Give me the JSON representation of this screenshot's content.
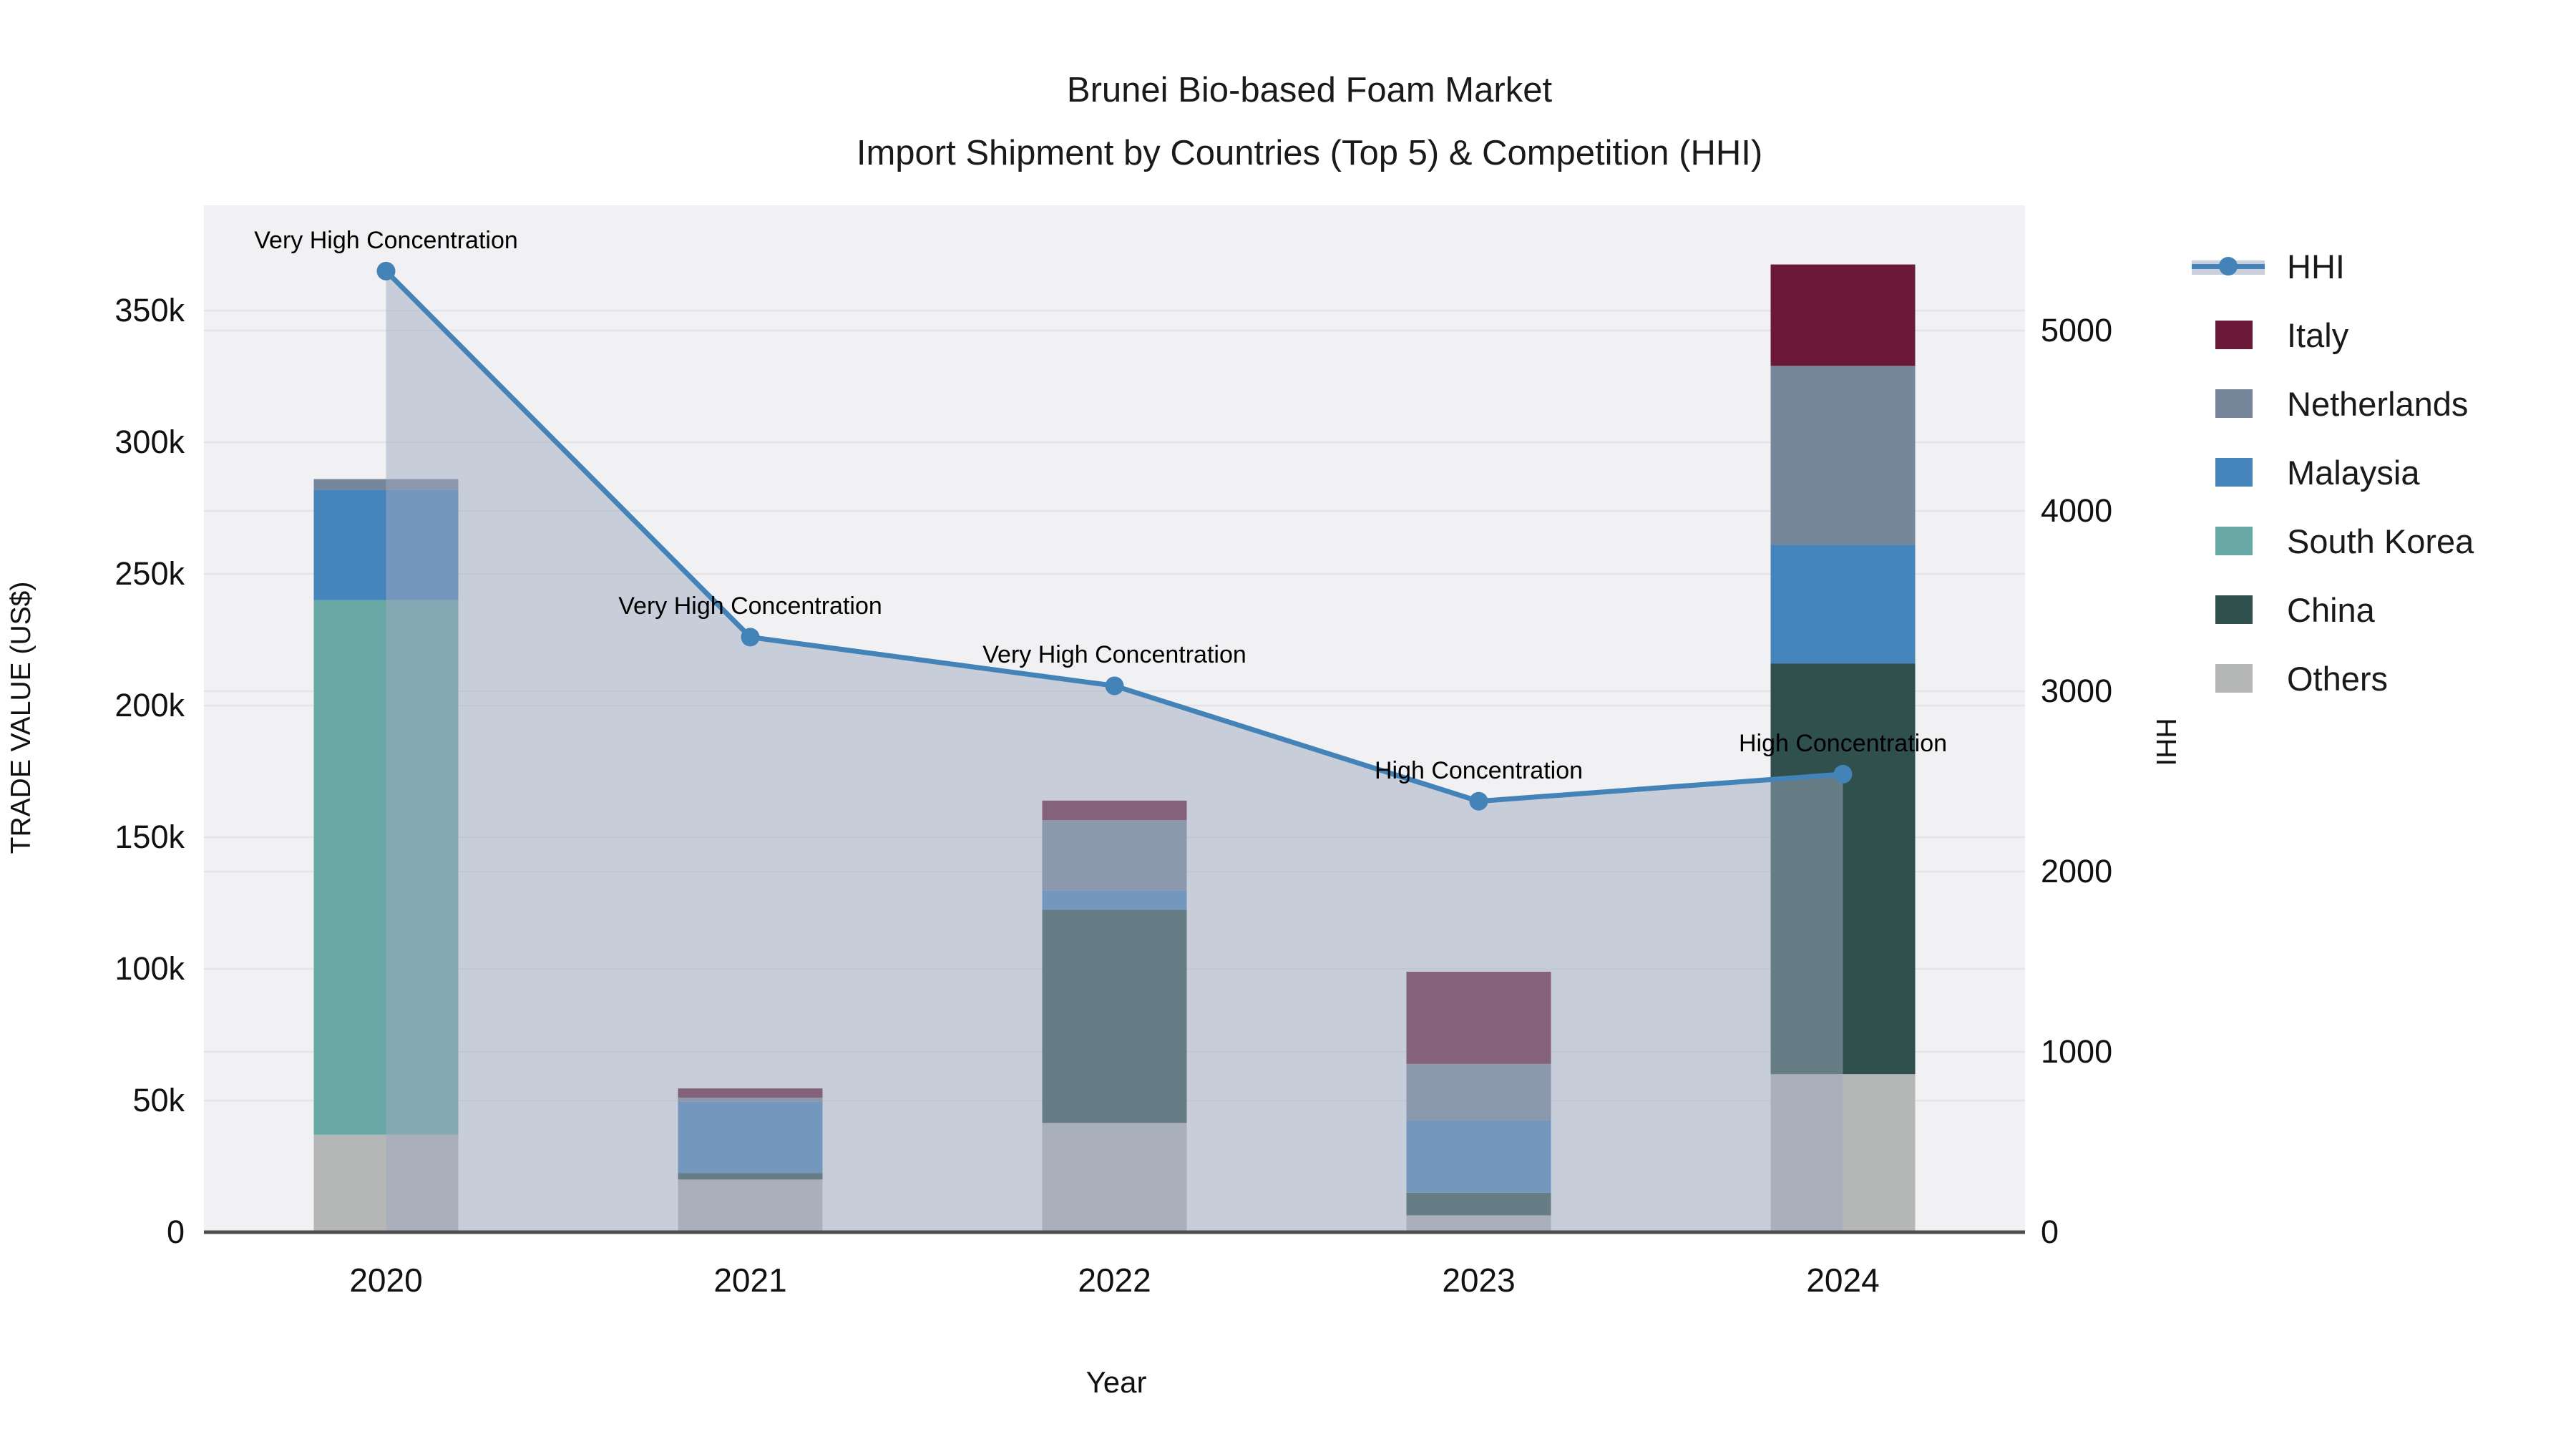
{
  "title": {
    "line1": "Brunei Bio-based Foam Market",
    "line2": "Import Shipment by Countries (Top 5) & Competition (HHI)"
  },
  "axes": {
    "xlabel": "Year",
    "ylabel_left": "TRADE VALUE (US$)",
    "ylabel_right": "HHI",
    "y_left_tick_labels": [
      "0",
      "50k",
      "100k",
      "150k",
      "200k",
      "250k",
      "300k",
      "350k"
    ],
    "y_left_tick_values": [
      0,
      50000,
      100000,
      150000,
      200000,
      250000,
      300000,
      350000
    ],
    "y_right_tick_labels": [
      "0",
      "1000",
      "2000",
      "3000",
      "4000",
      "5000"
    ],
    "y_right_tick_values": [
      0,
      1000,
      2000,
      3000,
      4000,
      5000
    ],
    "ylim_left": [
      0,
      390000
    ],
    "ylim_right": [
      0,
      5700
    ]
  },
  "legend": {
    "items": [
      {
        "label": "HHI",
        "type": "line",
        "color": "#4383b8"
      },
      {
        "label": "Italy",
        "type": "box",
        "color": "#6a1a38"
      },
      {
        "label": "Netherlands",
        "type": "box",
        "color": "#76879c"
      },
      {
        "label": "Malaysia",
        "type": "box",
        "color": "#4685bb"
      },
      {
        "label": "South Korea",
        "type": "box",
        "color": "#68a9a6"
      },
      {
        "label": "China",
        "type": "box",
        "color": "#2f504d"
      },
      {
        "label": "Others",
        "type": "box",
        "color": "#b5b7b7"
      }
    ]
  },
  "colors": {
    "hhi_line": "#4383b8",
    "hhi_area": "rgba(160,170,192,0.5)",
    "plot_bg": "#f1f1f4",
    "grid": "#e4e4e8",
    "axis_line": "#4d4d4d"
  },
  "chart_data": {
    "type": "bar",
    "subtype": "stacked-bars-with-line-overlay",
    "categories": [
      "2020",
      "2021",
      "2022",
      "2023",
      "2024"
    ],
    "stack_order_bottom_to_top": [
      "Others",
      "China",
      "South Korea",
      "Malaysia",
      "Netherlands",
      "Italy"
    ],
    "series": [
      {
        "name": "Others",
        "color": "#b5b7b7",
        "values": [
          37000,
          20000,
          41500,
          6400,
          60000
        ]
      },
      {
        "name": "China",
        "color": "#2f504d",
        "values": [
          0,
          2500,
          81000,
          8600,
          156000
        ]
      },
      {
        "name": "South Korea",
        "color": "#68a9a6",
        "values": [
          203000,
          0,
          0,
          0,
          0
        ]
      },
      {
        "name": "Malaysia",
        "color": "#4685bb",
        "values": [
          42000,
          27000,
          7300,
          27400,
          45000
        ]
      },
      {
        "name": "Netherlands",
        "color": "#76879c",
        "values": [
          4000,
          1600,
          26700,
          21500,
          68000
        ]
      },
      {
        "name": "Italy",
        "color": "#6a1a38",
        "values": [
          0,
          3500,
          7400,
          35000,
          38500
        ]
      }
    ],
    "line_series": {
      "name": "HHI",
      "axis": "right",
      "values": [
        5330,
        3300,
        3030,
        2390,
        2540
      ],
      "has_area_fill_to_zero": true
    },
    "annotations": [
      {
        "category": "2020",
        "text": "Very High Concentration"
      },
      {
        "category": "2021",
        "text": "Very High Concentration"
      },
      {
        "category": "2022",
        "text": "Very High Concentration"
      },
      {
        "category": "2023",
        "text": "High Concentration"
      },
      {
        "category": "2024",
        "text": "High Concentration"
      }
    ],
    "title": "Brunei Bio-based Foam Market Import Shipment by Countries (Top 5) & Competition (HHI)",
    "xlabel": "Year",
    "ylabel": "TRADE VALUE (US$)",
    "ylabel2": "HHI",
    "grid": true,
    "legend_position": "right"
  }
}
